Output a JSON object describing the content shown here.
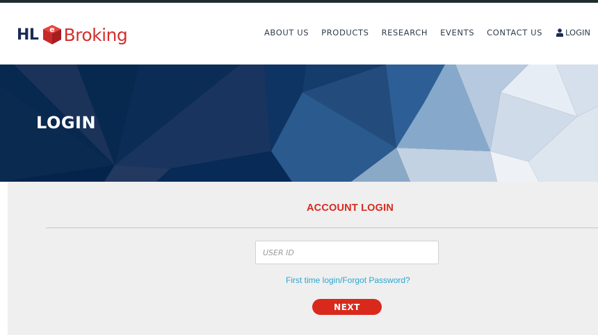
{
  "colors": {
    "brand_navy": "#1b2a57",
    "brand_red": "#d42f2b",
    "banner_dark": "#05244c",
    "link_blue": "#2aa6cf",
    "button_red": "#d9291c",
    "panel_grey": "#efefef"
  },
  "header": {
    "logo": {
      "hl_text": "HL",
      "cube_letter": "e",
      "brand_text": "Broking"
    },
    "nav": {
      "items": [
        {
          "label": "ABOUT US"
        },
        {
          "label": "PRODUCTS"
        },
        {
          "label": "RESEARCH"
        },
        {
          "label": "EVENTS"
        },
        {
          "label": "CONTACT US"
        }
      ],
      "login_label": "LOGIN",
      "login_icon": "user-icon"
    }
  },
  "banner": {
    "title": "LOGIN"
  },
  "login_form": {
    "title": "ACCOUNT LOGIN",
    "user_id_placeholder": "USER ID",
    "user_id_value": "",
    "forgot_link": "First time login/Forgot Password?",
    "submit_label": "NEXT"
  }
}
